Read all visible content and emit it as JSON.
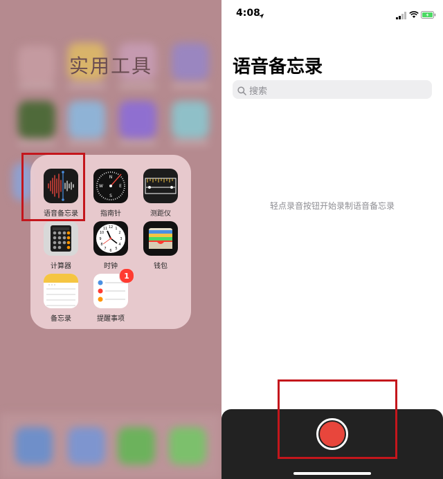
{
  "folder": {
    "title": "实用工具",
    "apps": [
      {
        "label": "语音备忘录",
        "icon": "voice-memos-icon"
      },
      {
        "label": "指南针",
        "icon": "compass-icon"
      },
      {
        "label": "测距仪",
        "icon": "measure-icon"
      },
      {
        "label": "计算器",
        "icon": "calculator-icon"
      },
      {
        "label": "时钟",
        "icon": "clock-icon"
      },
      {
        "label": "钱包",
        "icon": "wallet-icon"
      },
      {
        "label": "备忘录",
        "icon": "notes-icon"
      },
      {
        "label": "提醒事项",
        "icon": "reminders-icon",
        "badge": "1"
      }
    ]
  },
  "status_bar": {
    "time": "4:08"
  },
  "voice_memos": {
    "title": "语音备忘录",
    "search_placeholder": "搜索",
    "empty_text": "轻点录音按钮开始录制语音备忘录"
  },
  "colors": {
    "record": "#e8463c",
    "highlight": "#c4161c",
    "battery": "#4cd964"
  }
}
